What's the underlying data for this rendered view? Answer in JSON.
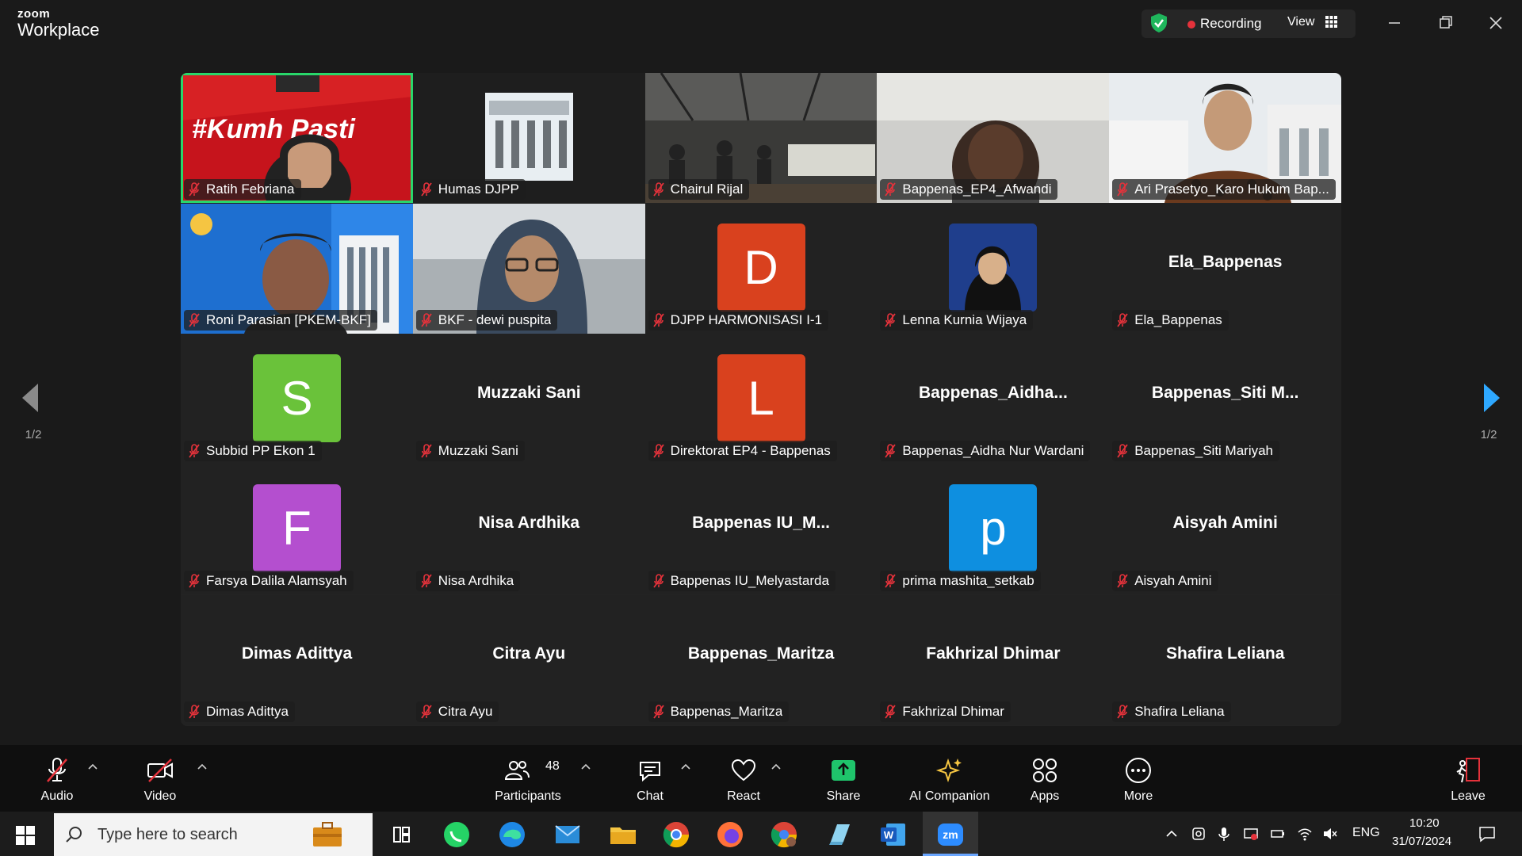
{
  "app": {
    "logo_small": "zoom",
    "logo_big": "Workplace",
    "recording_label": "Recording",
    "view_label": "View"
  },
  "colors": {
    "active_speaker": "#28d76a",
    "recording_dot": "#e5323b",
    "avatar_s": "#6ac23a",
    "avatar_orange": "#d9411e",
    "avatar_purple": "#b44fcf",
    "avatar_blue": "#0e8fe0"
  },
  "pagination": {
    "left": "1/2",
    "right": "1/2"
  },
  "tiles": [
    {
      "name": "Ratih Febriana",
      "kind": "video",
      "scene": "red-banner",
      "banner_text": "#Kumh  Pasti"
    },
    {
      "name": "Humas DJPP",
      "kind": "video",
      "scene": "building"
    },
    {
      "name": "Chairul Rijal",
      "kind": "video",
      "scene": "market"
    },
    {
      "name": "Bappenas_EP4_Afwandi",
      "kind": "video",
      "scene": "person-light"
    },
    {
      "name": "Ari Prasetyo_Karo Hukum Bap...",
      "kind": "video",
      "scene": "person-batik"
    },
    {
      "name": "Roni Parasian [PKEM-BKF]",
      "kind": "video",
      "scene": "blue-banner"
    },
    {
      "name": "BKF - dewi puspita",
      "kind": "video",
      "scene": "person-hijab"
    },
    {
      "name": "DJPP HARMONISASI I-1",
      "kind": "letter",
      "letter": "D",
      "color": "#d9411e"
    },
    {
      "name": "Lenna Kurnia Wijaya",
      "kind": "photo"
    },
    {
      "name": "Ela_Bappenas",
      "kind": "text",
      "display": "Ela_Bappenas"
    },
    {
      "name": "Subbid PP Ekon 1",
      "kind": "letter",
      "letter": "S",
      "color": "#6ac23a"
    },
    {
      "name": "Muzzaki Sani",
      "kind": "text",
      "display": "Muzzaki Sani"
    },
    {
      "name": "Direktorat EP4 - Bappenas",
      "kind": "letter",
      "letter": "L",
      "color": "#d9411e"
    },
    {
      "name": "Bappenas_Aidha Nur Wardani",
      "kind": "text",
      "display": "Bappenas_Aidha..."
    },
    {
      "name": "Bappenas_Siti Mariyah",
      "kind": "text",
      "display": "Bappenas_Siti  M..."
    },
    {
      "name": "Farsya Dalila Alamsyah",
      "kind": "letter",
      "letter": "F",
      "color": "#b44fcf"
    },
    {
      "name": "Nisa Ardhika",
      "kind": "text",
      "display": "Nisa Ardhika"
    },
    {
      "name": "Bappenas IU_Melyastarda",
      "kind": "text",
      "display": "Bappenas  IU_M..."
    },
    {
      "name": "prima mashita_setkab",
      "kind": "letter",
      "letter": "p",
      "color": "#0e8fe0"
    },
    {
      "name": "Aisyah Amini",
      "kind": "text",
      "display": "Aisyah Amini"
    },
    {
      "name": "Dimas Adittya",
      "kind": "text",
      "display": "Dimas Adittya"
    },
    {
      "name": "Citra Ayu",
      "kind": "text",
      "display": "Citra Ayu"
    },
    {
      "name": "Bappenas_Maritza",
      "kind": "text",
      "display": "Bappenas_Maritza"
    },
    {
      "name": "Fakhrizal Dhimar",
      "kind": "text",
      "display": "Fakhrizal Dhimar"
    },
    {
      "name": "Shafira Leliana",
      "kind": "text",
      "display": "Shafira Leliana"
    }
  ],
  "toolbar": {
    "audio": "Audio",
    "video": "Video",
    "participants": "Participants",
    "participants_count": "48",
    "chat": "Chat",
    "react": "React",
    "share": "Share",
    "ai": "AI Companion",
    "apps": "Apps",
    "more": "More",
    "leave": "Leave"
  },
  "taskbar": {
    "search_placeholder": "Type here to search",
    "language": "ENG",
    "time": "10:20",
    "date": "31/07/2024"
  }
}
